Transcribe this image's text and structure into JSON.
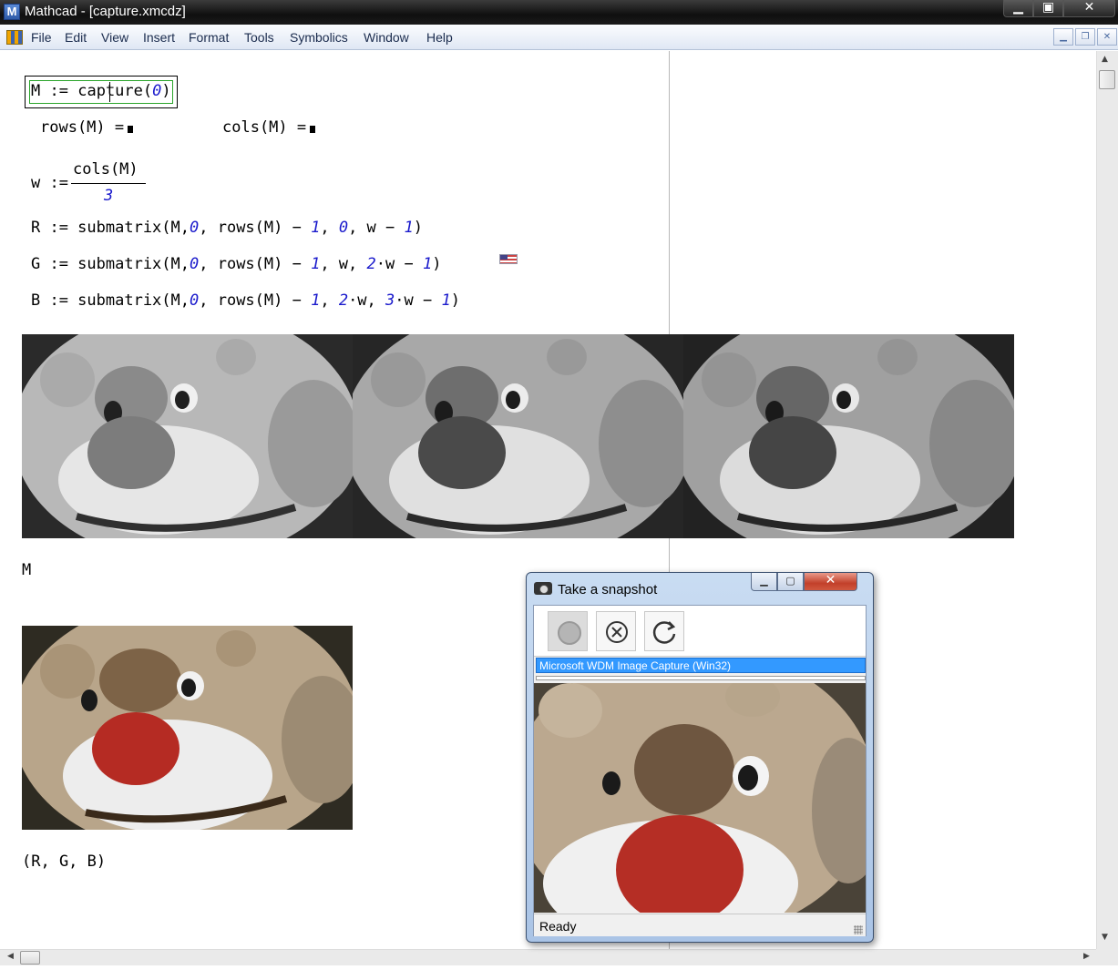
{
  "window": {
    "title": "Mathcad - [capture.xmcdz]",
    "app_icon": "M"
  },
  "menu": [
    "File",
    "Edit",
    "View",
    "Insert",
    "Format",
    "Tools",
    "Symbolics",
    "Window",
    "Help"
  ],
  "math": {
    "line1": {
      "var": "M",
      "assign": ":=",
      "fn": "capture",
      "open": "(",
      "arg": "0",
      "close": ")"
    },
    "rows": {
      "expr": "rows(M) ="
    },
    "cols": {
      "expr": "cols(M) ="
    },
    "w": {
      "lhs": "w :=",
      "numerator": "cols(M)",
      "denominator": "3"
    },
    "R": {
      "prefix": "R := submatrix(M,",
      "a": "0",
      "b": ", rows(M) − ",
      "c": "1",
      "d": ", ",
      "e": "0",
      "f": ", w − ",
      "g": "1",
      "end": ")"
    },
    "G": {
      "prefix": "G := submatrix(M,",
      "a": "0",
      "b": ", rows(M) − ",
      "c": "1",
      "d": ", w, ",
      "e": "2",
      "f": "·w − ",
      "g": "1",
      "end": ")"
    },
    "B": {
      "prefix": "B := submatrix(M,",
      "a": "0",
      "b": ", rows(M) − ",
      "c": "1",
      "d": ", ",
      "e": "2",
      "f": "·w, ",
      "g": "3",
      "h": "·w − ",
      "i": "1",
      "end": ")"
    },
    "label_M": "M",
    "label_RGB": "(R, G, B)"
  },
  "images": {
    "grayscale_channels": [
      "red-channel-image",
      "green-channel-image",
      "blue-channel-image"
    ],
    "color_image": "bear-color-image"
  },
  "snapshot_dialog": {
    "title": "Take a snapshot",
    "close_glyph": "✕",
    "device": "Microsoft WDM Image Capture (Win32)",
    "status": "Ready",
    "buttons": [
      "record-icon",
      "cancel-icon",
      "refresh-icon"
    ]
  },
  "colors": {
    "titlebar": "#1a1a1a",
    "menubar": "#dfe7f4",
    "number_blue": "#1a1acc",
    "region_green": "#2aa52a",
    "selection_blue": "#3399ff",
    "dialog_close": "#c2402a"
  }
}
